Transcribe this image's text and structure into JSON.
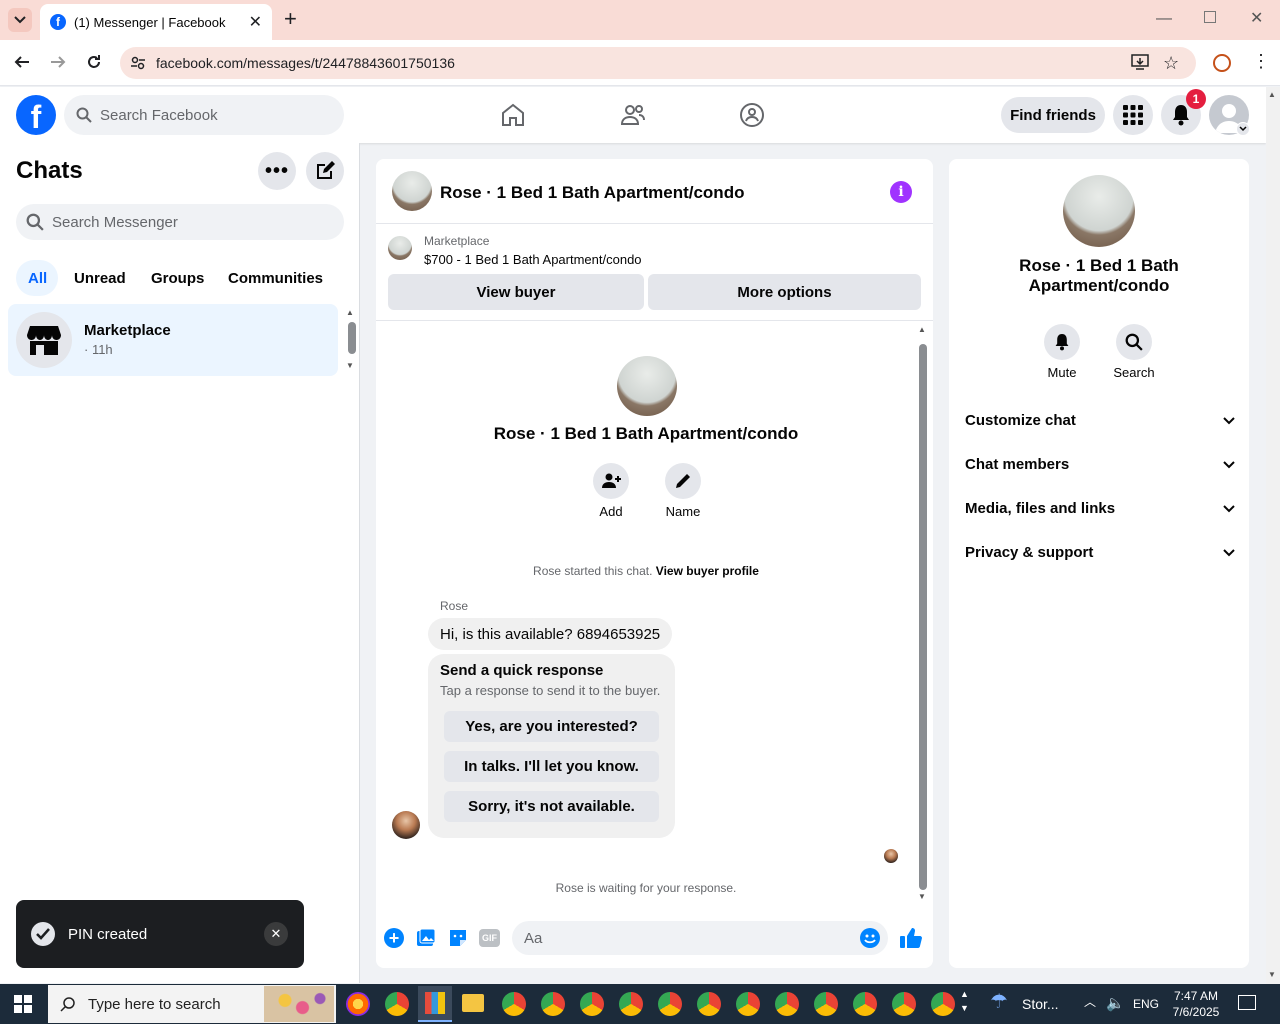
{
  "browser": {
    "tab_title": "(1) Messenger | Facebook",
    "url": "facebook.com/messages/t/24478843601750136"
  },
  "fb_header": {
    "search_placeholder": "Search Facebook",
    "find_friends": "Find friends",
    "notification_count": "1"
  },
  "chats": {
    "title": "Chats",
    "search_placeholder": "Search Messenger",
    "filters": [
      "All",
      "Unread",
      "Groups",
      "Communities"
    ],
    "list": [
      {
        "name": "Marketplace",
        "meta": "· 11h"
      }
    ]
  },
  "chat": {
    "title": "Rose · 1 Bed 1 Bath Apartment/condo",
    "listing_source": "Marketplace",
    "listing_text": "$700 - 1 Bed 1 Bath Apartment/condo",
    "view_buyer": "View buyer",
    "more_options": "More options",
    "profile_name": "Rose · 1 Bed 1 Bath Apartment/condo",
    "add_label": "Add",
    "name_label": "Name",
    "started_text": "Rose started this chat.",
    "view_buyer_profile": "View buyer profile",
    "sender": "Rose",
    "message": "Hi, is this available? 6894653925",
    "quick_title": "Send a quick response",
    "quick_subtitle": "Tap a response to send it to the buyer.",
    "quick_responses": [
      "Yes, are you interested?",
      "In talks. I'll let you know.",
      "Sorry, it's not available."
    ],
    "waiting_text": "Rose is waiting for your response.",
    "composer_placeholder": "Aa"
  },
  "info": {
    "name": "Rose · 1 Bed 1 Bath Apartment/condo",
    "mute": "Mute",
    "search": "Search",
    "sections": [
      "Customize chat",
      "Chat members",
      "Media, files and links",
      "Privacy & support"
    ]
  },
  "toast": {
    "text": "PIN created"
  },
  "taskbar": {
    "search_placeholder": "Type here to search",
    "weather": "Stor...",
    "lang": "ENG",
    "time": "7:47 AM",
    "date": "7/6/2025"
  },
  "colors": {
    "fb_blue": "#0866ff",
    "info_purple": "#a033ff",
    "messenger_blue": "#0084ff"
  }
}
